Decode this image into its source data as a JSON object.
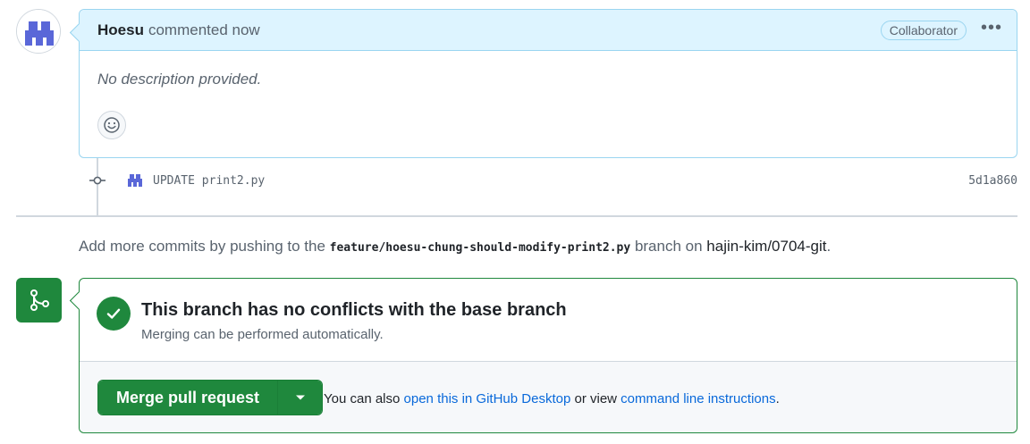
{
  "comment": {
    "author": "Hoesu",
    "action": "commented now",
    "role_badge": "Collaborator",
    "more_icon": "kebab-horizontal-icon",
    "body": "No description provided.",
    "reaction_icon": "smiley-icon"
  },
  "commit": {
    "message": "UPDATE print2.py",
    "sha": "5d1a860"
  },
  "push_hint": {
    "prefix": "Add more commits by pushing to the",
    "branch": "feature/hoesu-chung-should-modify-print2.py",
    "middle": "branch on",
    "repo": "hajin-kim/0704-git",
    "suffix": "."
  },
  "merge": {
    "status_title": "This branch has no conflicts with the base branch",
    "status_sub": "Merging can be performed automatically.",
    "button_label": "Merge pull request",
    "alt_prefix": "You can also",
    "desktop_link": "open this in GitHub Desktop",
    "alt_middle": "or view",
    "cli_link": "command line instructions",
    "alt_suffix": "."
  },
  "colors": {
    "accent_blue": "#0969da",
    "merge_green": "#1f883d",
    "header_blue_bg": "#ddf4ff",
    "header_blue_border": "#9ad5f0"
  }
}
